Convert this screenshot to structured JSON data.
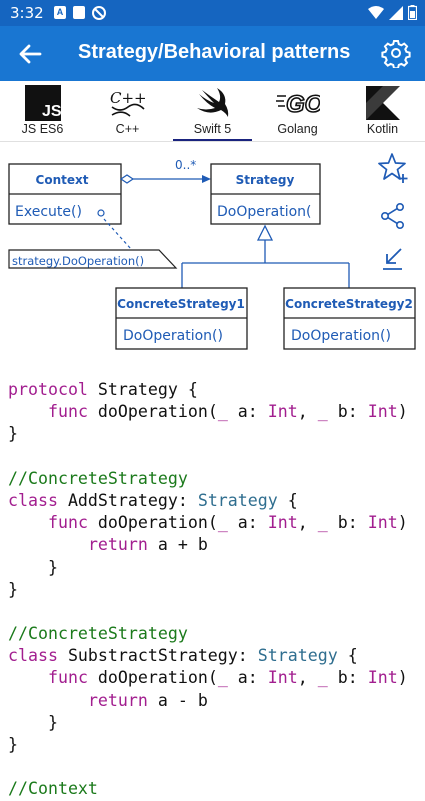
{
  "status": {
    "time": "3:32"
  },
  "appbar": {
    "title": "Strategy/Behavioral patterns",
    "back_icon": "arrow-back-icon",
    "settings_icon": "gear-icon"
  },
  "tabs": [
    {
      "label": "JS ES6",
      "logo": "JS"
    },
    {
      "label": "C++",
      "logo": "C++"
    },
    {
      "label": "Swift 5",
      "logo": "swift-bird",
      "active": true
    },
    {
      "label": "Golang",
      "logo": "GO"
    },
    {
      "label": "Kotlin",
      "logo": "kotlin-k"
    }
  ],
  "diagram": {
    "context": {
      "title": "Context",
      "method": "Execute()"
    },
    "multiplicity": "0..*",
    "strategy": {
      "title": "Strategy",
      "method": "DoOperation("
    },
    "note": "strategy.DoOperation()",
    "concrete1": {
      "title": "ConcreteStrategy1",
      "method": "DoOperation()"
    },
    "concrete2": {
      "title": "ConcreteStrategy2",
      "method": "DoOperation()"
    }
  },
  "actions": {
    "favorite_icon": "star-plus-icon",
    "share_icon": "share-icon",
    "minimize_icon": "arrow-collapse-icon"
  },
  "code": {
    "l1": {
      "a": "protocol",
      "b": " Strategy {"
    },
    "l2": {
      "a": "    ",
      "b": "func",
      "c": " doOperation(",
      "d": "_",
      "e": " a: ",
      "f": "Int",
      "g": ", ",
      "h": "_",
      "i": " b: ",
      "j": "Int",
      "k": ")"
    },
    "l3": "}",
    "l5": "//ConcreteStrategy",
    "l6": {
      "a": "class",
      "b": " AddStrategy: ",
      "c": "Strategy",
      "d": " {"
    },
    "l7": {
      "a": "    ",
      "b": "func",
      "c": " doOperation(",
      "d": "_",
      "e": " a: ",
      "f": "Int",
      "g": ", ",
      "h": "_",
      "i": " b: ",
      "j": "Int",
      "k": ")"
    },
    "l8": {
      "a": "        ",
      "b": "return",
      "c": " a + b"
    },
    "l9": "    }",
    "l10": "}",
    "l12": "//ConcreteStrategy",
    "l13": {
      "a": "class",
      "b": " SubstractStrategy: ",
      "c": "Strategy",
      "d": " {"
    },
    "l14": {
      "a": "    ",
      "b": "func",
      "c": " doOperation(",
      "d": "_",
      "e": " a: ",
      "f": "Int",
      "g": ", ",
      "h": "_",
      "i": " b: ",
      "j": "Int",
      "k": ")"
    },
    "l15": {
      "a": "        ",
      "b": "return",
      "c": " a - b"
    },
    "l16": "    }",
    "l17": "}",
    "l19": "//Context"
  }
}
